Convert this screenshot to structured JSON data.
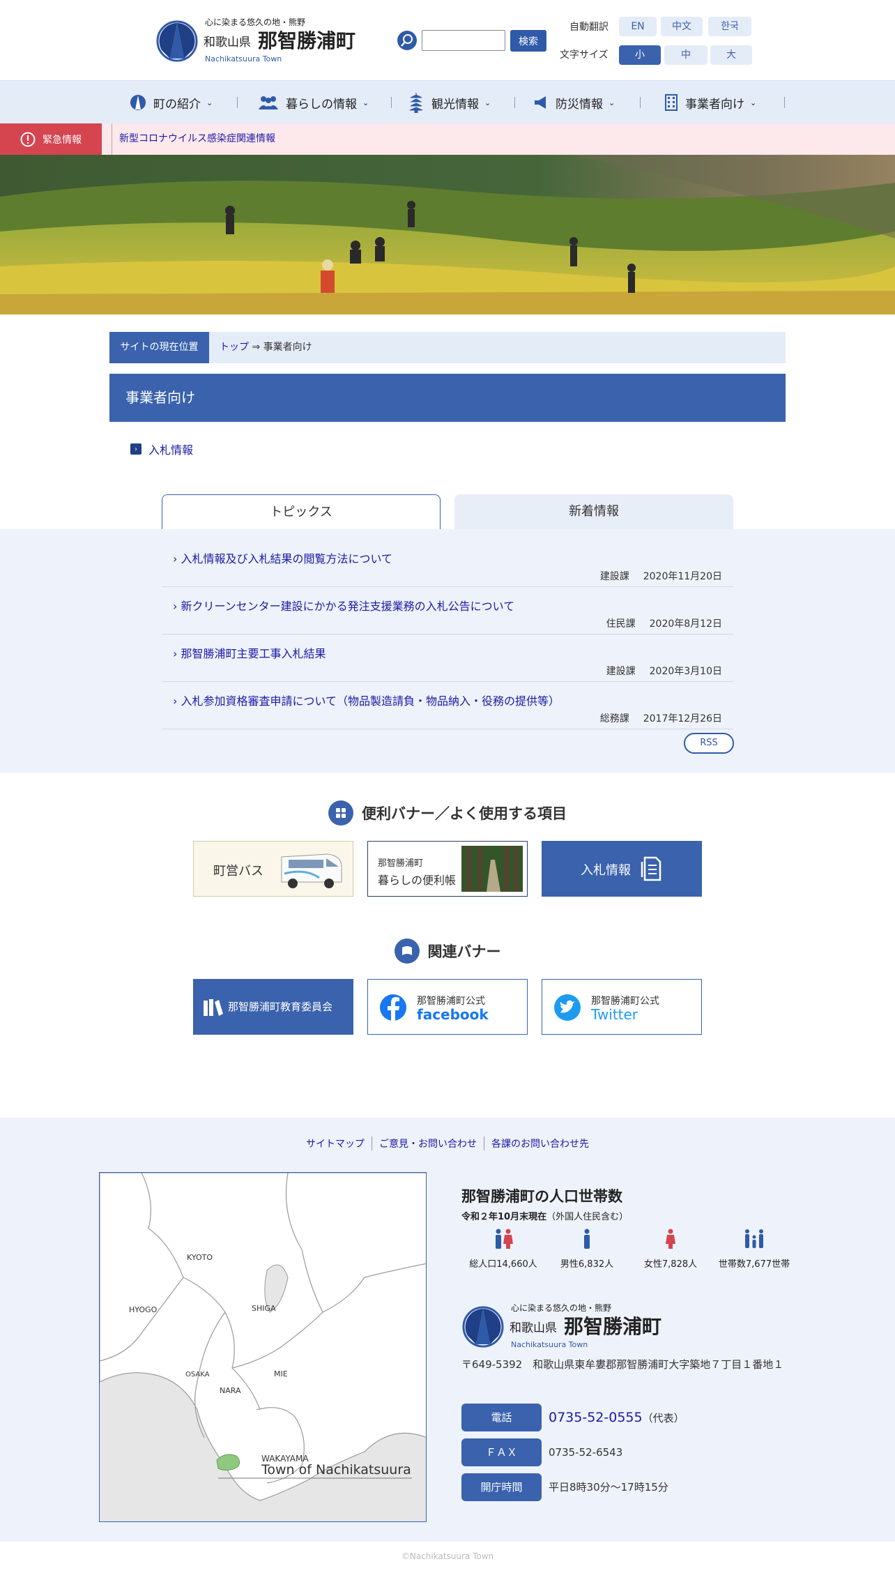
{
  "header": {
    "logo": {
      "tagline": "心に染まる悠久の地・熊野",
      "prefecture": "和歌山県",
      "town": "那智勝浦町",
      "roman": "Nachikatsuura Town"
    },
    "search": {
      "placeholder": "",
      "button": "検索"
    },
    "translate": {
      "label": "自動翻訳",
      "options": [
        "EN",
        "中文",
        "한국"
      ]
    },
    "font_size": {
      "label": "文字サイズ",
      "options": [
        "小",
        "中",
        "大"
      ],
      "selected": "小"
    }
  },
  "nav": {
    "items": [
      "町の紹介",
      "暮らしの情報",
      "観光情報",
      "防災情報",
      "事業者向け"
    ]
  },
  "emergency": {
    "label": "緊急情報",
    "link": "新型コロナウイルス感染症関連情報"
  },
  "breadcrumb": {
    "label": "サイトの現在位置",
    "top": "トップ",
    "arrow": "⇒",
    "current": "事業者向け"
  },
  "page": {
    "title": "事業者向け",
    "sublinks": [
      "入札情報"
    ]
  },
  "tabs": [
    "トピックス",
    "新着情報"
  ],
  "news": [
    {
      "title": "入札情報及び入札結果の閲覧方法について",
      "dept": "建設課",
      "date": "2020年11月20日"
    },
    {
      "title": "新クリーンセンター建設にかかる発注支援業務の入札公告について",
      "dept": "住民課",
      "date": "2020年8月12日"
    },
    {
      "title": "那智勝浦町主要工事入札結果",
      "dept": "建設課",
      "date": "2020年3月10日"
    },
    {
      "title": "入札参加資格審査申請について（物品製造請負・物品納入・役務の提供等）",
      "dept": "総務課",
      "date": "2017年12月26日"
    }
  ],
  "rss": "RSS",
  "banners": {
    "title": "便利バナー／よく使用する項目",
    "bus": "町営バス",
    "life_line1": "那智勝浦町",
    "life_line2": "暮らしの便利帳",
    "bid": "入札情報"
  },
  "related": {
    "title": "関連バナー",
    "edu": "那智勝浦町教育委員会",
    "fb_line1": "那智勝浦町公式",
    "fb_line2": "facebook",
    "tw_line1": "那智勝浦町公式",
    "tw_line2": "Twitter"
  },
  "footer": {
    "links": [
      "サイトマップ",
      "ご意見・お問い合わせ",
      "各課のお問い合わせ先"
    ],
    "map": {
      "labels": [
        "KYOTO",
        "HYOGO",
        "SHIGA",
        "OSAKA",
        "NARA",
        "MIE",
        "WAKAYAMA",
        "Town of Nachikatsuura"
      ]
    },
    "population": {
      "title": "那智勝浦町の人口世帯数",
      "as_of": "令和２年10月末現在",
      "note": "（外国人住民含む）",
      "stats": [
        "総人口14,660人",
        "男性6,832人",
        "女性7,828人",
        "世帯数7,677世帯"
      ]
    },
    "address": "〒649-5392　和歌山県東牟婁郡那智勝浦町大字築地７丁目１番地１",
    "contacts": [
      {
        "label": "電話",
        "value": "0735-52-0555",
        "suffix": "（代表）"
      },
      {
        "label": "ＦＡＸ",
        "value": "0735-52-6543",
        "suffix": ""
      },
      {
        "label": "開庁時間",
        "value": "平日8時30分～17時15分",
        "suffix": ""
      }
    ],
    "copyright": "©Nachikatsuura Town"
  },
  "colors": {
    "primary": "#3a62ad",
    "nav_bg": "#e4ecf8",
    "emergency": "#d4454f",
    "link": "#1a1aa6"
  }
}
